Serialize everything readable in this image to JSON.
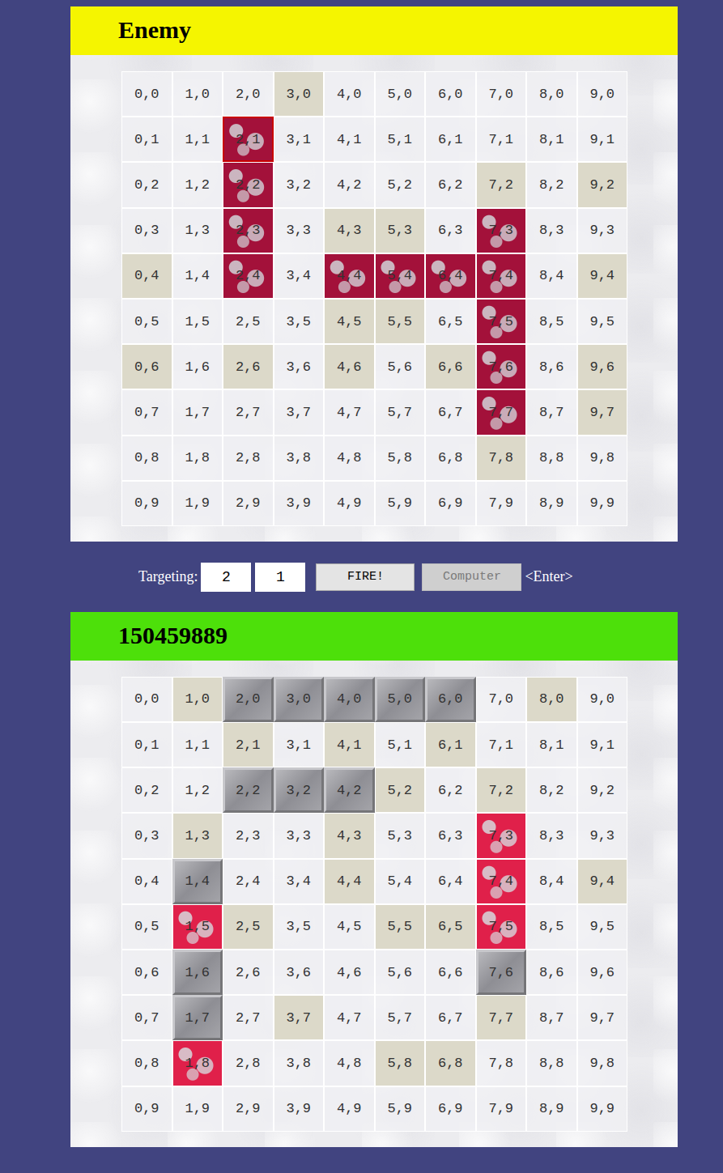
{
  "boards": [
    {
      "title": "Enemy",
      "targetable": true,
      "rows": [
        [
          {
            "label": "0,0",
            "kind": "empty"
          },
          {
            "label": "1,0",
            "kind": "empty"
          },
          {
            "label": "2,0",
            "kind": "empty"
          },
          {
            "label": "3,0",
            "kind": "miss"
          },
          {
            "label": "4,0",
            "kind": "empty"
          },
          {
            "label": "5,0",
            "kind": "empty"
          },
          {
            "label": "6,0",
            "kind": "empty"
          },
          {
            "label": "7,0",
            "kind": "empty"
          },
          {
            "label": "8,0",
            "kind": "empty"
          },
          {
            "label": "9,0",
            "kind": "empty"
          }
        ],
        [
          {
            "label": "0,1",
            "kind": "empty"
          },
          {
            "label": "1,1",
            "kind": "empty"
          },
          {
            "label": "2,1",
            "kind": "hit"
          },
          {
            "label": "3,1",
            "kind": "empty"
          },
          {
            "label": "4,1",
            "kind": "empty"
          },
          {
            "label": "5,1",
            "kind": "empty"
          },
          {
            "label": "6,1",
            "kind": "empty"
          },
          {
            "label": "7,1",
            "kind": "empty"
          },
          {
            "label": "8,1",
            "kind": "empty"
          },
          {
            "label": "9,1",
            "kind": "empty"
          }
        ],
        [
          {
            "label": "0,2",
            "kind": "empty"
          },
          {
            "label": "1,2",
            "kind": "empty"
          },
          {
            "label": "2,2",
            "kind": "hit"
          },
          {
            "label": "3,2",
            "kind": "empty"
          },
          {
            "label": "4,2",
            "kind": "empty"
          },
          {
            "label": "5,2",
            "kind": "empty"
          },
          {
            "label": "6,2",
            "kind": "empty"
          },
          {
            "label": "7,2",
            "kind": "miss"
          },
          {
            "label": "8,2",
            "kind": "empty"
          },
          {
            "label": "9,2",
            "kind": "miss"
          }
        ],
        [
          {
            "label": "0,3",
            "kind": "empty"
          },
          {
            "label": "1,3",
            "kind": "empty"
          },
          {
            "label": "2,3",
            "kind": "hit"
          },
          {
            "label": "3,3",
            "kind": "empty"
          },
          {
            "label": "4,3",
            "kind": "miss"
          },
          {
            "label": "5,3",
            "kind": "miss"
          },
          {
            "label": "6,3",
            "kind": "empty"
          },
          {
            "label": "7,3",
            "kind": "hit"
          },
          {
            "label": "8,3",
            "kind": "empty"
          },
          {
            "label": "9,3",
            "kind": "empty"
          }
        ],
        [
          {
            "label": "0,4",
            "kind": "miss"
          },
          {
            "label": "1,4",
            "kind": "empty"
          },
          {
            "label": "2,4",
            "kind": "hit"
          },
          {
            "label": "3,4",
            "kind": "empty"
          },
          {
            "label": "4,4",
            "kind": "hit"
          },
          {
            "label": "5,4",
            "kind": "hit"
          },
          {
            "label": "6,4",
            "kind": "hit"
          },
          {
            "label": "7,4",
            "kind": "hit"
          },
          {
            "label": "8,4",
            "kind": "empty"
          },
          {
            "label": "9,4",
            "kind": "miss"
          }
        ],
        [
          {
            "label": "0,5",
            "kind": "empty"
          },
          {
            "label": "1,5",
            "kind": "empty"
          },
          {
            "label": "2,5",
            "kind": "empty"
          },
          {
            "label": "3,5",
            "kind": "empty"
          },
          {
            "label": "4,5",
            "kind": "miss"
          },
          {
            "label": "5,5",
            "kind": "miss"
          },
          {
            "label": "6,5",
            "kind": "empty"
          },
          {
            "label": "7,5",
            "kind": "hit"
          },
          {
            "label": "8,5",
            "kind": "empty"
          },
          {
            "label": "9,5",
            "kind": "empty"
          }
        ],
        [
          {
            "label": "0,6",
            "kind": "miss"
          },
          {
            "label": "1,6",
            "kind": "empty"
          },
          {
            "label": "2,6",
            "kind": "miss"
          },
          {
            "label": "3,6",
            "kind": "empty"
          },
          {
            "label": "4,6",
            "kind": "miss"
          },
          {
            "label": "5,6",
            "kind": "empty"
          },
          {
            "label": "6,6",
            "kind": "miss"
          },
          {
            "label": "7,6",
            "kind": "hit"
          },
          {
            "label": "8,6",
            "kind": "empty"
          },
          {
            "label": "9,6",
            "kind": "miss"
          }
        ],
        [
          {
            "label": "0,7",
            "kind": "empty"
          },
          {
            "label": "1,7",
            "kind": "empty"
          },
          {
            "label": "2,7",
            "kind": "empty"
          },
          {
            "label": "3,7",
            "kind": "empty"
          },
          {
            "label": "4,7",
            "kind": "empty"
          },
          {
            "label": "5,7",
            "kind": "empty"
          },
          {
            "label": "6,7",
            "kind": "empty"
          },
          {
            "label": "7,7",
            "kind": "hit"
          },
          {
            "label": "8,7",
            "kind": "empty"
          },
          {
            "label": "9,7",
            "kind": "miss"
          }
        ],
        [
          {
            "label": "0,8",
            "kind": "empty"
          },
          {
            "label": "1,8",
            "kind": "empty"
          },
          {
            "label": "2,8",
            "kind": "empty"
          },
          {
            "label": "3,8",
            "kind": "empty"
          },
          {
            "label": "4,8",
            "kind": "empty"
          },
          {
            "label": "5,8",
            "kind": "empty"
          },
          {
            "label": "6,8",
            "kind": "empty"
          },
          {
            "label": "7,8",
            "kind": "miss"
          },
          {
            "label": "8,8",
            "kind": "empty"
          },
          {
            "label": "9,8",
            "kind": "empty"
          }
        ],
        [
          {
            "label": "0,9",
            "kind": "empty"
          },
          {
            "label": "1,9",
            "kind": "empty"
          },
          {
            "label": "2,9",
            "kind": "empty"
          },
          {
            "label": "3,9",
            "kind": "empty"
          },
          {
            "label": "4,9",
            "kind": "empty"
          },
          {
            "label": "5,9",
            "kind": "empty"
          },
          {
            "label": "6,9",
            "kind": "empty"
          },
          {
            "label": "7,9",
            "kind": "empty"
          },
          {
            "label": "8,9",
            "kind": "empty"
          },
          {
            "label": "9,9",
            "kind": "empty"
          }
        ]
      ]
    },
    {
      "title": "150459889",
      "targetable": false,
      "rows": [
        [
          {
            "label": "0,0",
            "kind": "empty"
          },
          {
            "label": "1,0",
            "kind": "miss"
          },
          {
            "label": "2,0",
            "kind": "ship"
          },
          {
            "label": "3,0",
            "kind": "ship"
          },
          {
            "label": "4,0",
            "kind": "ship"
          },
          {
            "label": "5,0",
            "kind": "ship"
          },
          {
            "label": "6,0",
            "kind": "ship"
          },
          {
            "label": "7,0",
            "kind": "empty"
          },
          {
            "label": "8,0",
            "kind": "miss"
          },
          {
            "label": "9,0",
            "kind": "empty"
          }
        ],
        [
          {
            "label": "0,1",
            "kind": "empty"
          },
          {
            "label": "1,1",
            "kind": "empty"
          },
          {
            "label": "2,1",
            "kind": "miss"
          },
          {
            "label": "3,1",
            "kind": "empty"
          },
          {
            "label": "4,1",
            "kind": "miss"
          },
          {
            "label": "5,1",
            "kind": "empty"
          },
          {
            "label": "6,1",
            "kind": "miss"
          },
          {
            "label": "7,1",
            "kind": "empty"
          },
          {
            "label": "8,1",
            "kind": "empty"
          },
          {
            "label": "9,1",
            "kind": "empty"
          }
        ],
        [
          {
            "label": "0,2",
            "kind": "empty"
          },
          {
            "label": "1,2",
            "kind": "empty"
          },
          {
            "label": "2,2",
            "kind": "ship"
          },
          {
            "label": "3,2",
            "kind": "ship"
          },
          {
            "label": "4,2",
            "kind": "ship"
          },
          {
            "label": "5,2",
            "kind": "miss"
          },
          {
            "label": "6,2",
            "kind": "empty"
          },
          {
            "label": "7,2",
            "kind": "miss"
          },
          {
            "label": "8,2",
            "kind": "empty"
          },
          {
            "label": "9,2",
            "kind": "empty"
          }
        ],
        [
          {
            "label": "0,3",
            "kind": "empty"
          },
          {
            "label": "1,3",
            "kind": "miss"
          },
          {
            "label": "2,3",
            "kind": "empty"
          },
          {
            "label": "3,3",
            "kind": "empty"
          },
          {
            "label": "4,3",
            "kind": "miss"
          },
          {
            "label": "5,3",
            "kind": "empty"
          },
          {
            "label": "6,3",
            "kind": "empty"
          },
          {
            "label": "7,3",
            "kind": "hit"
          },
          {
            "label": "8,3",
            "kind": "empty"
          },
          {
            "label": "9,3",
            "kind": "empty"
          }
        ],
        [
          {
            "label": "0,4",
            "kind": "empty"
          },
          {
            "label": "1,4",
            "kind": "ship"
          },
          {
            "label": "2,4",
            "kind": "empty"
          },
          {
            "label": "3,4",
            "kind": "empty"
          },
          {
            "label": "4,4",
            "kind": "miss"
          },
          {
            "label": "5,4",
            "kind": "empty"
          },
          {
            "label": "6,4",
            "kind": "empty"
          },
          {
            "label": "7,4",
            "kind": "hit"
          },
          {
            "label": "8,4",
            "kind": "empty"
          },
          {
            "label": "9,4",
            "kind": "miss"
          }
        ],
        [
          {
            "label": "0,5",
            "kind": "empty"
          },
          {
            "label": "1,5",
            "kind": "hit"
          },
          {
            "label": "2,5",
            "kind": "miss"
          },
          {
            "label": "3,5",
            "kind": "empty"
          },
          {
            "label": "4,5",
            "kind": "empty"
          },
          {
            "label": "5,5",
            "kind": "miss"
          },
          {
            "label": "6,5",
            "kind": "miss"
          },
          {
            "label": "7,5",
            "kind": "hit"
          },
          {
            "label": "8,5",
            "kind": "empty"
          },
          {
            "label": "9,5",
            "kind": "empty"
          }
        ],
        [
          {
            "label": "0,6",
            "kind": "empty"
          },
          {
            "label": "1,6",
            "kind": "ship"
          },
          {
            "label": "2,6",
            "kind": "empty"
          },
          {
            "label": "3,6",
            "kind": "empty"
          },
          {
            "label": "4,6",
            "kind": "empty"
          },
          {
            "label": "5,6",
            "kind": "empty"
          },
          {
            "label": "6,6",
            "kind": "empty"
          },
          {
            "label": "7,6",
            "kind": "ship"
          },
          {
            "label": "8,6",
            "kind": "empty"
          },
          {
            "label": "9,6",
            "kind": "empty"
          }
        ],
        [
          {
            "label": "0,7",
            "kind": "empty"
          },
          {
            "label": "1,7",
            "kind": "ship"
          },
          {
            "label": "2,7",
            "kind": "empty"
          },
          {
            "label": "3,7",
            "kind": "miss"
          },
          {
            "label": "4,7",
            "kind": "empty"
          },
          {
            "label": "5,7",
            "kind": "empty"
          },
          {
            "label": "6,7",
            "kind": "empty"
          },
          {
            "label": "7,7",
            "kind": "miss"
          },
          {
            "label": "8,7",
            "kind": "empty"
          },
          {
            "label": "9,7",
            "kind": "empty"
          }
        ],
        [
          {
            "label": "0,8",
            "kind": "empty"
          },
          {
            "label": "1,8",
            "kind": "hit"
          },
          {
            "label": "2,8",
            "kind": "empty"
          },
          {
            "label": "3,8",
            "kind": "empty"
          },
          {
            "label": "4,8",
            "kind": "empty"
          },
          {
            "label": "5,8",
            "kind": "miss"
          },
          {
            "label": "6,8",
            "kind": "miss"
          },
          {
            "label": "7,8",
            "kind": "empty"
          },
          {
            "label": "8,8",
            "kind": "empty"
          },
          {
            "label": "9,8",
            "kind": "empty"
          }
        ],
        [
          {
            "label": "0,9",
            "kind": "empty"
          },
          {
            "label": "1,9",
            "kind": "empty"
          },
          {
            "label": "2,9",
            "kind": "empty"
          },
          {
            "label": "3,9",
            "kind": "empty"
          },
          {
            "label": "4,9",
            "kind": "empty"
          },
          {
            "label": "5,9",
            "kind": "empty"
          },
          {
            "label": "6,9",
            "kind": "empty"
          },
          {
            "label": "7,9",
            "kind": "empty"
          },
          {
            "label": "8,9",
            "kind": "empty"
          },
          {
            "label": "9,9",
            "kind": "empty"
          }
        ]
      ]
    }
  ],
  "controls": {
    "label": "Targeting:",
    "target": {
      "x": "2",
      "y": "1"
    },
    "fire": {
      "label": "FIRE!",
      "disabled": false
    },
    "computer": {
      "label": "Computer",
      "disabled": true
    },
    "hint": "<Enter>"
  }
}
